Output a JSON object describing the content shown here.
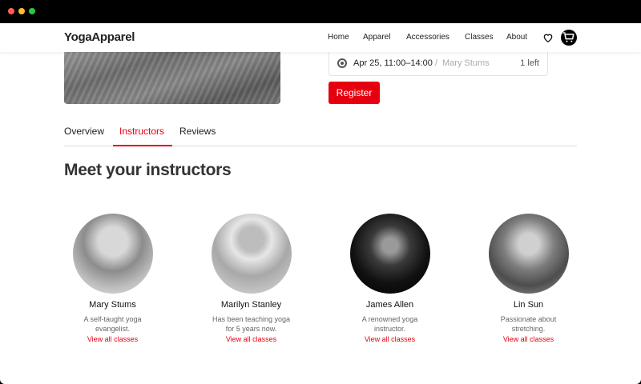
{
  "brand": "YogaApparel",
  "nav": {
    "items": [
      "Home",
      "Apparel",
      "Accessories",
      "Classes",
      "About"
    ]
  },
  "session": {
    "date": "Apr 25, 11:00–14:00",
    "separator": "/",
    "instructor": "Mary Stums",
    "spots": "1 left"
  },
  "register_label": "Register",
  "tabs": [
    "Overview",
    "Instructors",
    "Reviews"
  ],
  "active_tab": "Instructors",
  "heading": "Meet your instructors",
  "instructors": [
    {
      "name": "Mary Stums",
      "bio": "A self-taught yoga evangelist.",
      "link": "View all classes"
    },
    {
      "name": "Marilyn Stanley",
      "bio": "Has been teaching yoga for 5 years now.",
      "link": "View all classes"
    },
    {
      "name": "James Allen",
      "bio": "A renowned yoga instructor.",
      "link": "View all classes"
    },
    {
      "name": "Lin Sun",
      "bio": "Passionate about stretching.",
      "link": "View all classes"
    }
  ],
  "colors": {
    "accent": "#e6000f",
    "text": "#222222",
    "muted": "#666666"
  },
  "icons": [
    "heart-icon",
    "cart-icon"
  ]
}
